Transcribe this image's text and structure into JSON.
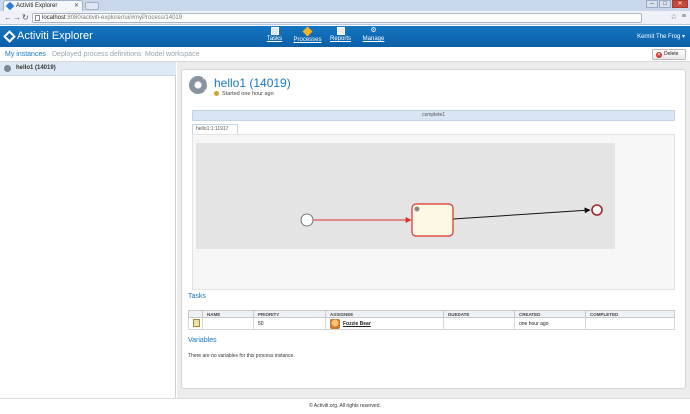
{
  "browser": {
    "tab_title": "Activiti Explorer",
    "url_host": "localhost",
    "url_path": ":8080/activiti-explorer/ui/#myProcess/14019"
  },
  "header": {
    "logo_text": "Activiti Explorer",
    "nav": [
      {
        "label": "Tasks",
        "icon": "tasks-icon"
      },
      {
        "label": "Processes",
        "icon": "processes-icon"
      },
      {
        "label": "Reports",
        "icon": "reports-icon"
      },
      {
        "label": "Manage",
        "icon": "manage-icon"
      }
    ],
    "active_nav": "Processes",
    "user": "Kermit The Frog ▾"
  },
  "subnav": {
    "items": [
      "My instances",
      "Deployed process definitions",
      "Model workspace"
    ],
    "active": "My instances",
    "delete_label": "Delete"
  },
  "sidebar": {
    "instances": [
      {
        "label": "hello1 (14019)",
        "selected": true
      }
    ]
  },
  "detail": {
    "title": "hello1 (14019)",
    "started": "Started one hour ago",
    "diagram_bar_label": "complete1",
    "diagram_tab_label": "hello1:1:11917"
  },
  "tasks": {
    "section_title": "Tasks",
    "columns": [
      "",
      "NAME",
      "PRIORITY",
      "ASSIGNEE",
      "DUEDATE",
      "CREATED",
      "COMPLETED"
    ],
    "rows": [
      {
        "name": "",
        "priority": "50",
        "assignee": "Fozzie Bear",
        "duedate": "",
        "created": "one hour ago",
        "completed": ""
      }
    ]
  },
  "variables": {
    "section_title": "Variables",
    "empty_text": "There are no variables for this process instance."
  },
  "footer": "© Activiti.org. All rights reserved.",
  "colors": {
    "header_blue": "#0b5fa6",
    "link_blue": "#1b79c0",
    "flow_active": "#d9322b"
  }
}
